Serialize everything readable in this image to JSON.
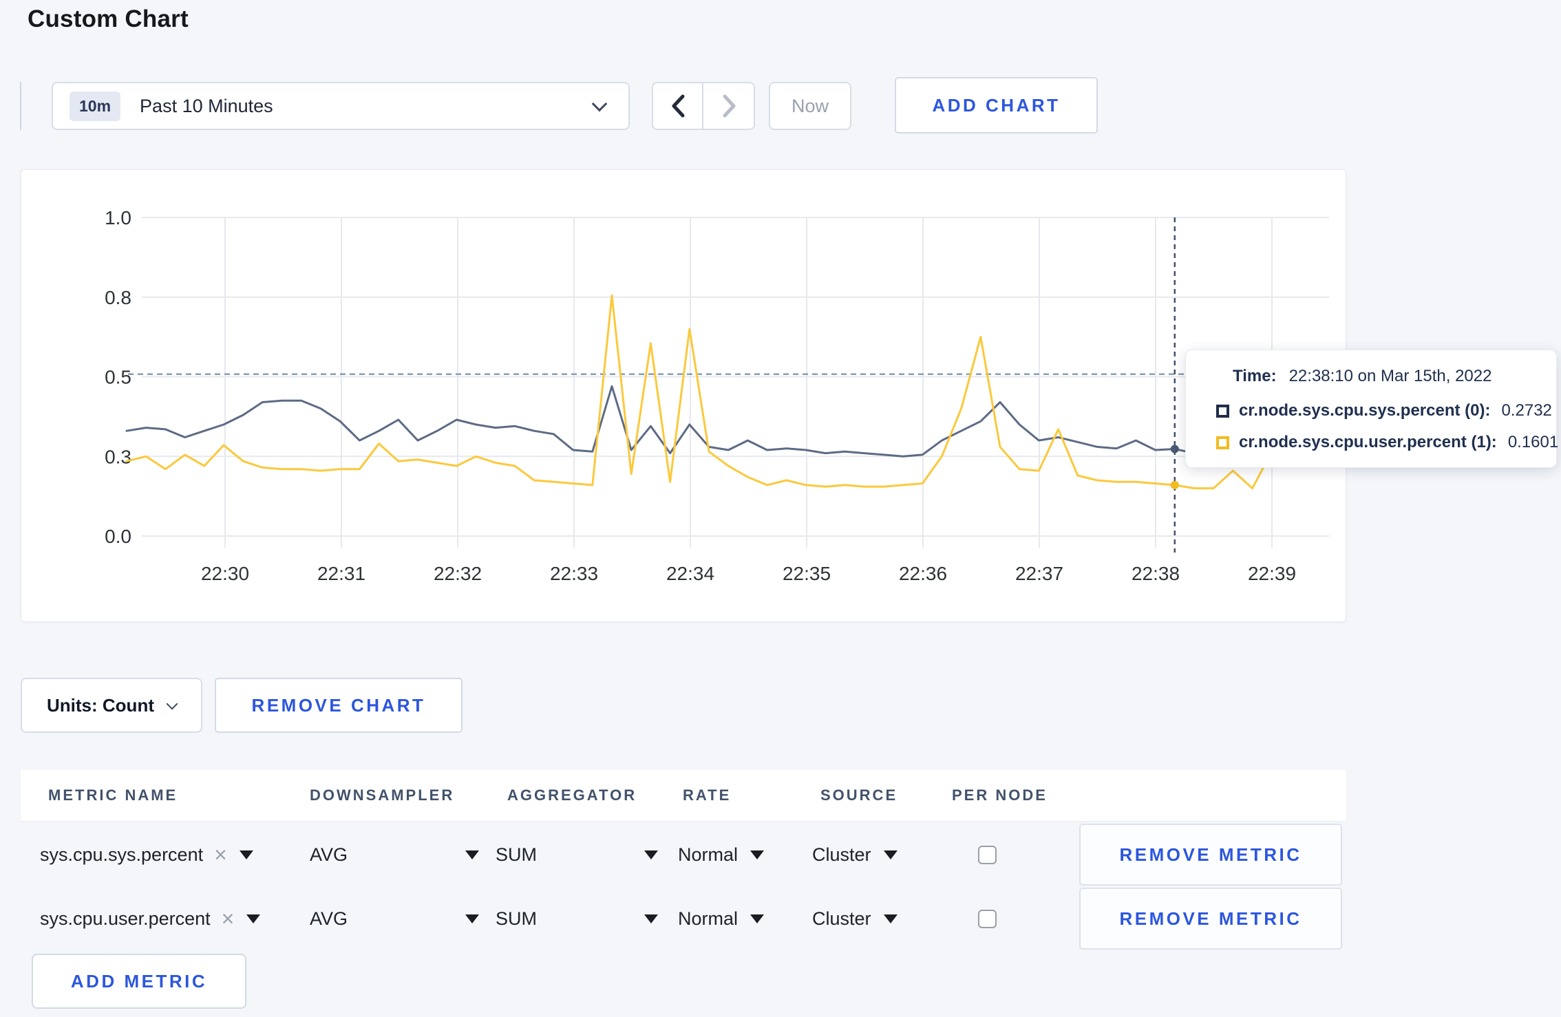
{
  "page": {
    "title": "Custom Chart"
  },
  "toolbar": {
    "time_range": {
      "badge": "10m",
      "label": "Past 10 Minutes"
    },
    "now_label": "Now",
    "add_chart_label": "ADD CHART"
  },
  "chart_controls": {
    "units_label": "Units: Count",
    "remove_chart_label": "REMOVE CHART"
  },
  "tooltip": {
    "time_label": "Time:",
    "time_value": "22:38:10 on Mar 15th, 2022",
    "rows": [
      {
        "name": "cr.node.sys.cpu.sys.percent (0):",
        "value": "0.2732"
      },
      {
        "name": "cr.node.sys.cpu.user.percent (1):",
        "value": "0.1601"
      }
    ]
  },
  "chart_data": {
    "type": "line",
    "title": "",
    "xlabel": "",
    "ylabel": "",
    "ylim": [
      0,
      1
    ],
    "grid": true,
    "y_tick_labels": [
      "1.0",
      "0.8",
      "0.5",
      "0.3",
      "0.0"
    ],
    "y_tick_values": [
      1.0,
      0.75,
      0.5,
      0.25,
      0.0
    ],
    "x_tick_labels": [
      "22:30",
      "22:31",
      "22:32",
      "22:33",
      "22:34",
      "22:35",
      "22:36",
      "22:37",
      "22:38",
      "22:39"
    ],
    "x_start": "22:29:10",
    "x_step_seconds": 10,
    "threshold_line": {
      "value": 0.508,
      "color": "#85a0b2",
      "style": "dashed"
    },
    "crosshair": {
      "index": 54,
      "time": "22:38:10",
      "color": "#44516b",
      "points": [
        {
          "series": "cr.node.sys.cpu.sys.percent",
          "value": 0.2732,
          "color": "#4a5a74"
        },
        {
          "series": "cr.node.sys.cpu.user.percent",
          "value": 0.1601,
          "color": "#f2bb20"
        }
      ]
    },
    "series": [
      {
        "name": "cr.node.sys.cpu.sys.percent",
        "color": "#5d6b84",
        "values": [
          0.33,
          0.34,
          0.335,
          0.31,
          0.33,
          0.35,
          0.38,
          0.42,
          0.425,
          0.425,
          0.4,
          0.36,
          0.3,
          0.33,
          0.365,
          0.3,
          0.33,
          0.365,
          0.35,
          0.34,
          0.345,
          0.33,
          0.32,
          0.27,
          0.265,
          0.47,
          0.27,
          0.345,
          0.26,
          0.35,
          0.28,
          0.27,
          0.3,
          0.27,
          0.275,
          0.27,
          0.26,
          0.265,
          0.26,
          0.255,
          0.25,
          0.255,
          0.3,
          0.33,
          0.36,
          0.42,
          0.35,
          0.3,
          0.31,
          0.295,
          0.28,
          0.275,
          0.3,
          0.27,
          0.2732,
          0.26,
          0.28,
          0.29,
          0.27,
          0.28,
          0.285
        ]
      },
      {
        "name": "cr.node.sys.cpu.user.percent",
        "color": "#fbc93d",
        "values": [
          0.235,
          0.25,
          0.21,
          0.255,
          0.22,
          0.285,
          0.235,
          0.215,
          0.21,
          0.21,
          0.205,
          0.21,
          0.21,
          0.29,
          0.235,
          0.24,
          0.23,
          0.22,
          0.25,
          0.23,
          0.22,
          0.175,
          0.17,
          0.165,
          0.16,
          0.755,
          0.195,
          0.605,
          0.17,
          0.65,
          0.265,
          0.22,
          0.185,
          0.16,
          0.175,
          0.16,
          0.155,
          0.16,
          0.155,
          0.155,
          0.16,
          0.165,
          0.25,
          0.4,
          0.625,
          0.28,
          0.21,
          0.205,
          0.335,
          0.19,
          0.175,
          0.17,
          0.17,
          0.165,
          0.1601,
          0.15,
          0.15,
          0.205,
          0.15,
          0.265,
          0.24
        ]
      }
    ]
  },
  "metrics_table": {
    "headers": [
      "METRIC NAME",
      "DOWNSAMPLER",
      "AGGREGATOR",
      "RATE",
      "SOURCE",
      "PER NODE"
    ],
    "rows": [
      {
        "metric": "sys.cpu.sys.percent",
        "downsampler": "AVG",
        "aggregator": "SUM",
        "rate": "Normal",
        "source": "Cluster",
        "per_node_checked": false,
        "remove_label": "REMOVE METRIC"
      },
      {
        "metric": "sys.cpu.user.percent",
        "downsampler": "AVG",
        "aggregator": "SUM",
        "rate": "Normal",
        "source": "Cluster",
        "per_node_checked": false,
        "remove_label": "REMOVE METRIC"
      }
    ],
    "add_metric_label": "ADD METRIC"
  }
}
